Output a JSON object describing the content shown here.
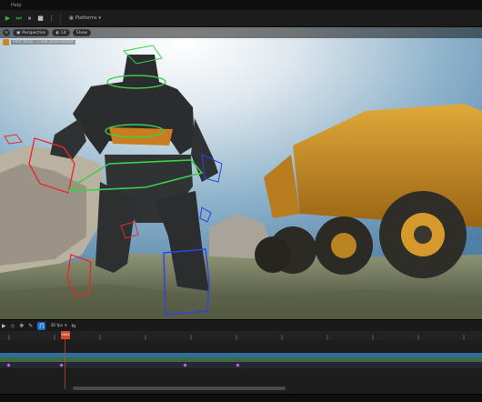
{
  "menu": {
    "help": "Help"
  },
  "toolbar": {
    "platforms": "Platforms"
  },
  "viewport": {
    "perspective": "Perspective",
    "lit": "Lit",
    "show": "Show",
    "pilot_text": "Pilot Actor : CineCameraActor"
  },
  "sequencer": {
    "fps": "30 fps",
    "playhead": "0000"
  }
}
